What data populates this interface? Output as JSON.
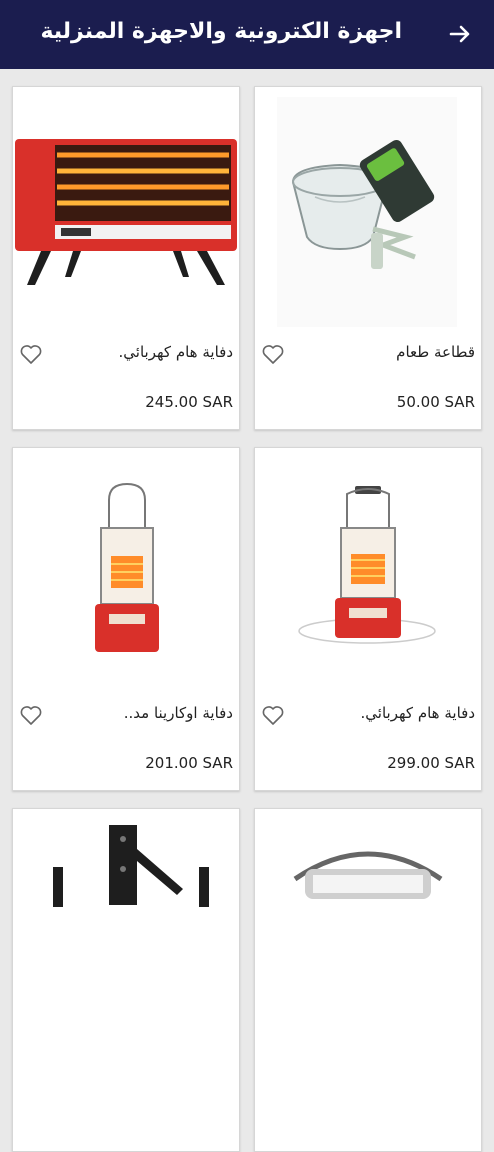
{
  "header": {
    "title": "اجهزة الكترونية والاجهزة المنزلية",
    "back_icon": "arrow-right-icon"
  },
  "products": [
    {
      "name": "قطاعة طعام",
      "price": "50.00 SAR",
      "image": "food-chopper"
    },
    {
      "name": "دفاية هام كهربائي.",
      "price": "245.00 SAR",
      "image": "electric-heater"
    },
    {
      "name": "دفاية هام كهربائي.",
      "price": "299.00 SAR",
      "image": "kerosene-heater"
    },
    {
      "name": "دفاية اوكارينا مد..",
      "price": "201.00 SAR",
      "image": "kerosene-heater"
    },
    {
      "name": "",
      "price": "",
      "image": "lantern-heater"
    },
    {
      "name": "",
      "price": "",
      "image": "tv-wall-mount"
    }
  ],
  "colors": {
    "header_bg": "#1b1d4f",
    "heater_red": "#d9302a"
  }
}
